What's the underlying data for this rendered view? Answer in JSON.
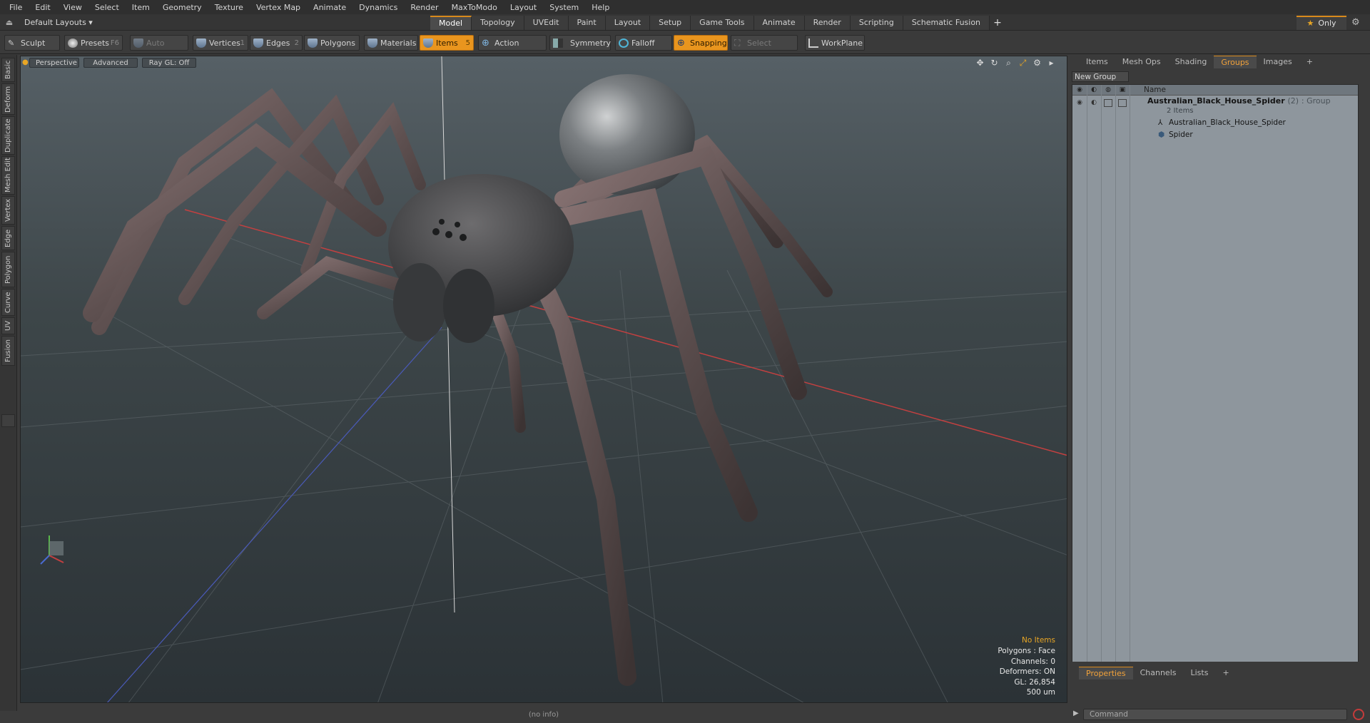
{
  "menu": [
    "File",
    "Edit",
    "View",
    "Select",
    "Item",
    "Geometry",
    "Texture",
    "Vertex Map",
    "Animate",
    "Dynamics",
    "Render",
    "MaxToModo",
    "Layout",
    "System",
    "Help"
  ],
  "layout": {
    "name": "Default Layouts ▾",
    "only_label": "Only"
  },
  "tabs": [
    {
      "label": "Model",
      "active": true
    },
    {
      "label": "Topology"
    },
    {
      "label": "UVEdit"
    },
    {
      "label": "Paint"
    },
    {
      "label": "Layout"
    },
    {
      "label": "Setup"
    },
    {
      "label": "Game Tools"
    },
    {
      "label": "Animate"
    },
    {
      "label": "Render"
    },
    {
      "label": "Scripting"
    },
    {
      "label": "Schematic Fusion"
    }
  ],
  "tab_add": "+",
  "toolbar": {
    "sculpt": "Sculpt",
    "presets": "Presets",
    "presets_key": "F6",
    "auto_select": "Auto Select",
    "vertices": "Vertices",
    "vertices_key": "1",
    "edges": "Edges",
    "edges_key": "2",
    "polygons": "Polygons",
    "materials": "Materials",
    "items": "Items",
    "items_key": "5",
    "action_center": "Action Center",
    "symmetry": "Symmetry",
    "falloff": "Falloff",
    "snapping": "Snapping",
    "select_through": "Select Through",
    "workplane": "WorkPlane"
  },
  "left_tabs": [
    "Basic",
    "Deform",
    "Duplicate",
    "Mesh Edit",
    "Vertex",
    "Edge",
    "Polygon",
    "Curve",
    "UV",
    "Fusion"
  ],
  "viewport": {
    "view": "Perspective",
    "mode": "Advanced",
    "raygl": "Ray GL: Off",
    "info": {
      "items": "No Items",
      "polygons": "Polygons : Face",
      "channels": "Channels: 0",
      "deformers": "Deformers: ON",
      "gl": "GL: 26,854",
      "scale": "500 um"
    }
  },
  "status": "(no info)",
  "right_panel": {
    "tabs": [
      {
        "label": "Items"
      },
      {
        "label": "Mesh Ops"
      },
      {
        "label": "Shading"
      },
      {
        "label": "Groups",
        "active": true
      },
      {
        "label": "Images"
      }
    ],
    "tab_add": "+",
    "new_group": "New Group",
    "name_header": "Name",
    "group": {
      "name": "Australian_Black_House_Spider",
      "count": "(2)",
      "type": ": Group",
      "sub": "2 Items"
    },
    "children": [
      "Australian_Black_House_Spider",
      "Spider"
    ],
    "bottom_tabs": [
      {
        "label": "Properties",
        "active": true
      },
      {
        "label": "Channels"
      },
      {
        "label": "Lists"
      }
    ],
    "bottom_add": "+",
    "command_placeholder": "Command"
  },
  "colors": {
    "accent": "#e9951e",
    "viewport_bg": "#3d4649",
    "list_bg": "#8e969d"
  }
}
